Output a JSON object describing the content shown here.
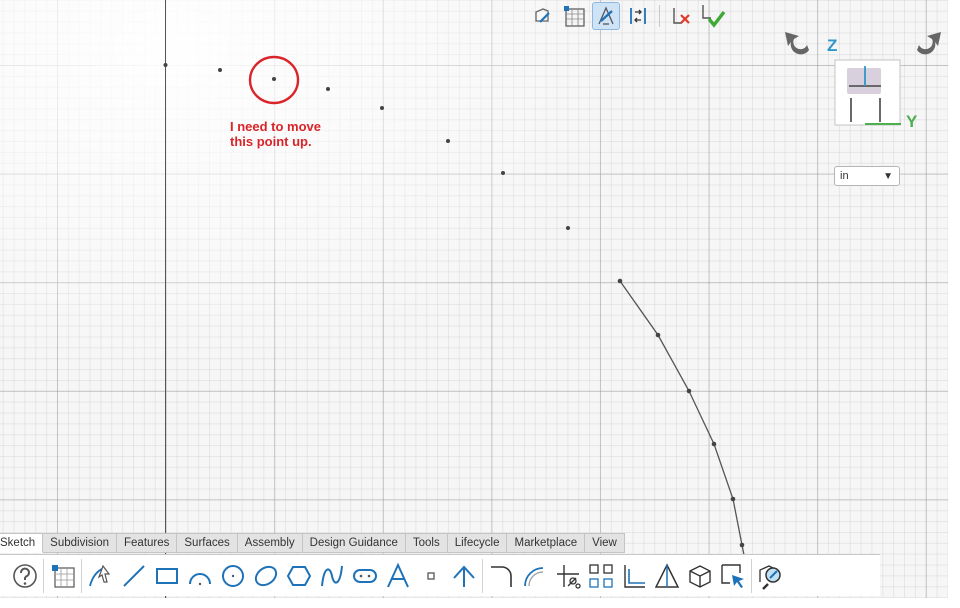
{
  "annotation": {
    "line1": "I need to move",
    "line2": "this point up."
  },
  "viewcube": {
    "axis_z": "Z",
    "axis_y": "Y"
  },
  "units": {
    "selected": "in"
  },
  "tabs": [
    "Sketch",
    "Subdivision",
    "Features",
    "Surfaces",
    "Assembly",
    "Design Guidance",
    "Tools",
    "Lifecycle",
    "Marketplace",
    "View"
  ],
  "active_tab": "Sketch",
  "colors": {
    "annotation_red": "#d9252a",
    "axis_blue": "#2f97c9",
    "axis_green": "#4caf50",
    "icon_blue": "#1e73b8",
    "active_bg": "#cfe3f7"
  },
  "top_toolbar_icons": [
    "sketch-edit-icon",
    "sketch-grid-icon",
    "snap-icon",
    "constraint-icon",
    "cancel-sketch-icon",
    "finish-sketch-icon"
  ],
  "bottom_toolbar_icons": [
    "help-icon",
    "sketch-grid-icon",
    "spline-icon",
    "line-icon",
    "rectangle-icon",
    "arc-icon",
    "circle-icon",
    "ellipse-icon",
    "polygon-icon",
    "curve-icon",
    "slot-icon",
    "text-icon",
    "point-icon",
    "construction-icon",
    "fillet-icon",
    "offset-icon",
    "trim-icon",
    "mirror-icon",
    "project-icon",
    "dimension-icon",
    "box-icon",
    "move-icon",
    "inspect-icon"
  ]
}
